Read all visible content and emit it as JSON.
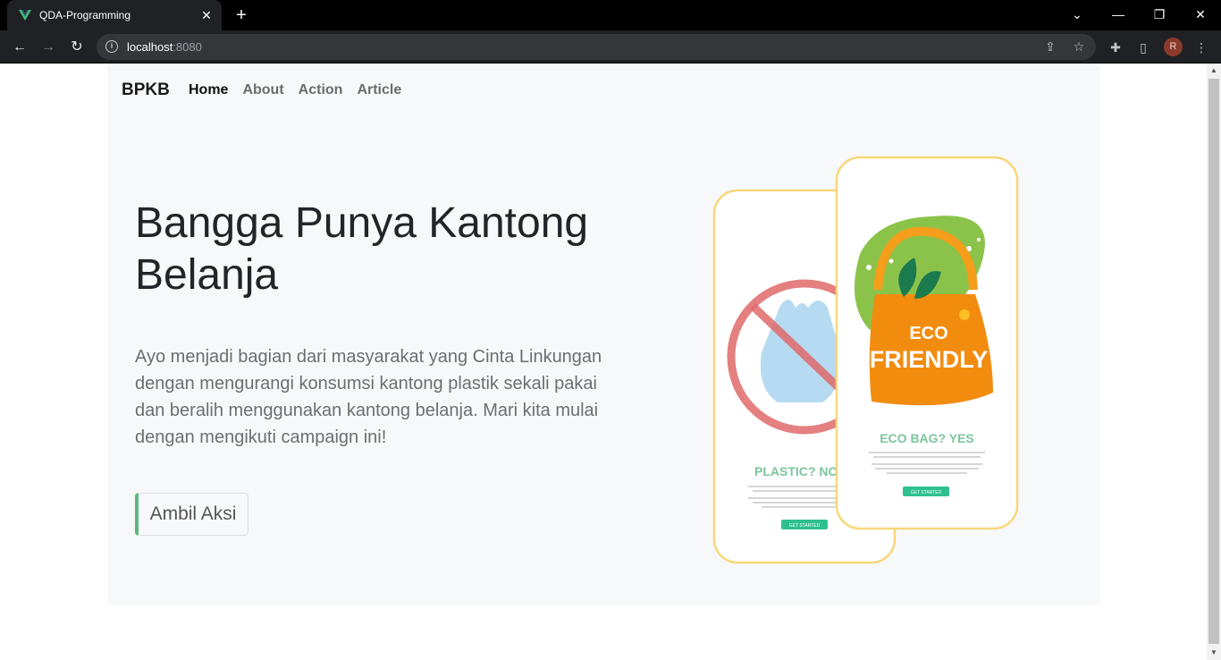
{
  "browser": {
    "tab_title": "QDA-Programming",
    "tab_close": "✕",
    "new_tab": "+",
    "url_host": "localhost",
    "url_port": ":8080",
    "profile_initial": "R"
  },
  "navbar": {
    "brand": "BPKB",
    "links": [
      "Home",
      "About",
      "Action",
      "Article"
    ]
  },
  "hero": {
    "title": "Bangga Punya Kantong Belanja",
    "description": "Ayo menjadi bagian dari masyarakat yang Cinta Linkungan dengan mengurangi konsumsi kantong plastik sekali pakai dan beralih menggunakan kantong belanja. Mari kita mulai dengan mengikuti campaign ini!",
    "cta_label": "Ambil Aksi"
  },
  "illustration": {
    "left_card_heading": "PLASTIC? NO",
    "left_card_button": "GET STARTED",
    "right_card_heading": "ECO BAG? YES",
    "right_card_button": "GET STARTED",
    "bag_text_line1": "ECO",
    "bag_text_line2": "FRIENDLY"
  },
  "colors": {
    "accent_green": "#5cb87a",
    "card_border": "#f7d77a",
    "heading_green": "#7bc59b",
    "button_teal": "#2ec08e",
    "bag_orange": "#f28c0f",
    "leaf_green": "#8bc34a"
  }
}
